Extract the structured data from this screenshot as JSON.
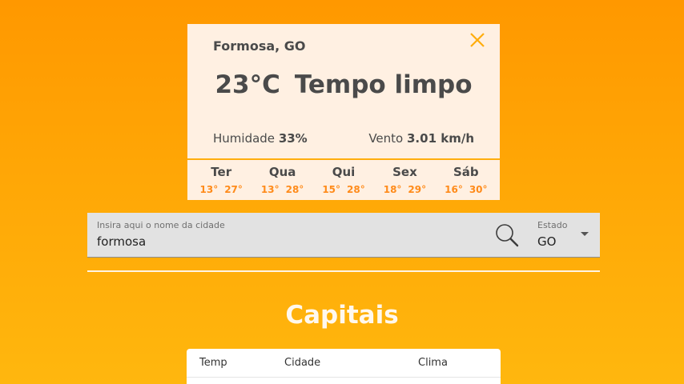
{
  "weather": {
    "city": "Formosa, GO",
    "temperature": "23°C",
    "condition": "Tempo limpo",
    "humidity_label": "Humidade",
    "humidity_value": "33%",
    "wind_label": "Vento",
    "wind_value": "3.01 km/h",
    "forecast": [
      {
        "day": "Ter",
        "min": "13°",
        "max": "27°"
      },
      {
        "day": "Qua",
        "min": "13°",
        "max": "28°"
      },
      {
        "day": "Qui",
        "min": "15°",
        "max": "28°"
      },
      {
        "day": "Sex",
        "min": "18°",
        "max": "29°"
      },
      {
        "day": "Sáb",
        "min": "16°",
        "max": "30°"
      }
    ]
  },
  "search": {
    "label": "Insira aqui o nome da cidade",
    "value": "formosa",
    "state_label": "Estado",
    "state_value": "GO"
  },
  "capitals": {
    "title": "Capitais",
    "columns": [
      "Temp",
      "Cidade",
      "Clima"
    ]
  },
  "icons": {
    "close": "close-icon",
    "search": "search-icon",
    "dropdown": "caret-down-icon"
  },
  "colors": {
    "background_top": "#ff9800",
    "background_bottom": "#ffb70e",
    "card": "#fff0e2",
    "accent": "#ffad0c",
    "forecast_temp": "#ff8b1a"
  }
}
